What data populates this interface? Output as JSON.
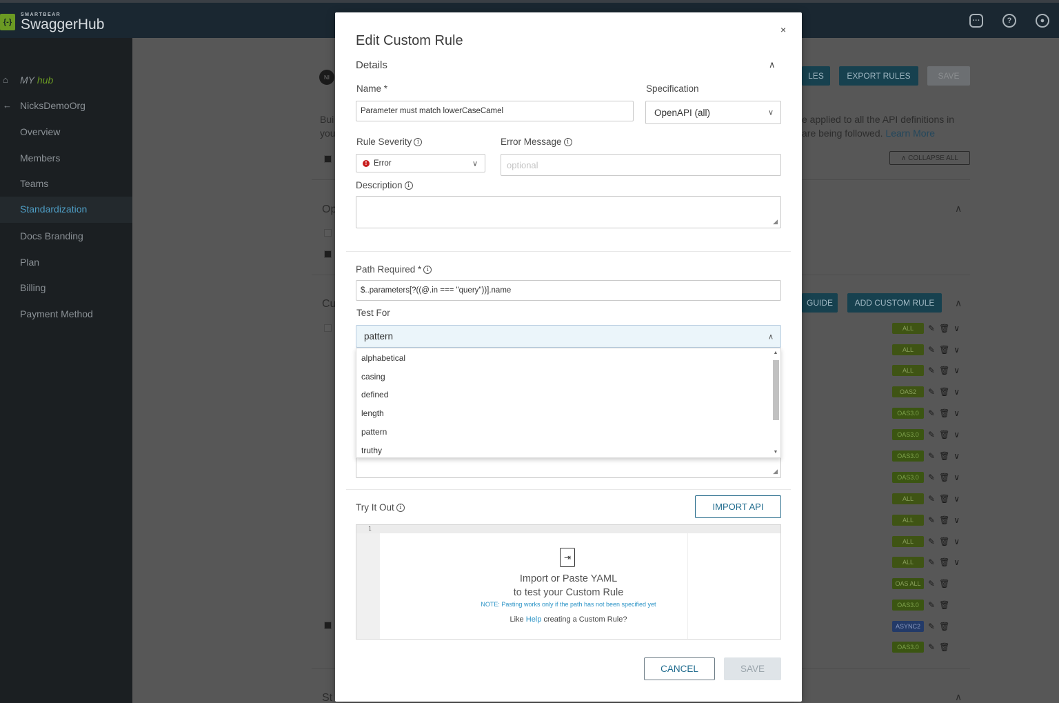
{
  "app": {
    "logo_small": "SMARTBEAR",
    "logo_main": "SwaggerHub",
    "logo_mark": "{-}"
  },
  "sidebar": {
    "myhub_my": "MY",
    "myhub_hub": "hub",
    "org": "NicksDemoOrg",
    "items": [
      {
        "label": "Overview"
      },
      {
        "label": "Members"
      },
      {
        "label": "Teams"
      },
      {
        "label": "Standardization"
      },
      {
        "label": "Docs Branding"
      },
      {
        "label": "Plan"
      },
      {
        "label": "Billing"
      },
      {
        "label": "Payment Method"
      }
    ]
  },
  "background": {
    "avatar_initials": "NI",
    "rules_btn": "LES",
    "export_btn": "EXPORT RULES",
    "save_btn": "SAVE",
    "desc_left1": "Bui",
    "desc_left2": "you",
    "desc_right1": "e applied to all the API definitions in",
    "desc_right2": "are being followed.",
    "learn_more": "Learn More",
    "collapse_all": "∧ COLLAPSE ALL",
    "section_op": "Op",
    "section_cu": "Cu",
    "section_st": "St",
    "guide_btn": "GUIDE",
    "add_custom_rule_btn": "ADD CUSTOM RULE",
    "rule_tags": [
      "ALL",
      "ALL",
      "ALL",
      "OAS2",
      "OAS3.0",
      "OAS3.0",
      "OAS3.0",
      "OAS3.0",
      "ALL",
      "ALL",
      "ALL",
      "ALL",
      "OAS ALL",
      "OAS3.0",
      "ASYNC2",
      "OAS3.0"
    ]
  },
  "modal": {
    "title": "Edit Custom Rule",
    "close": "×",
    "details_title": "Details",
    "name_label": "Name *",
    "name_value": "Parameter must match lowerCaseCamel",
    "spec_label": "Specification",
    "spec_value": "OpenAPI (all)",
    "severity_label": "Rule Severity",
    "severity_value": "Error",
    "error_msg_label": "Error Message",
    "error_msg_placeholder": "optional",
    "description_label": "Description",
    "description_value": "",
    "path_label": "Path Required *",
    "path_value": "$..parameters[?((@.in === \"query\"))].name",
    "test_for_label": "Test For",
    "test_for_value": "pattern",
    "test_for_options": [
      "alphabetical",
      "casing",
      "defined",
      "length",
      "pattern",
      "truthy"
    ],
    "try_it_out_label": "Try It Out",
    "import_api_btn": "IMPORT API",
    "editor_line_number": "1",
    "editor_main_1": "Import or Paste YAML",
    "editor_main_2": "to test your Custom Rule",
    "editor_note": "NOTE: Pasting works only if the path has not been specified yet",
    "editor_help_pre": "Like",
    "editor_help_link": "Help",
    "editor_help_post": "creating a Custom Rule?",
    "cancel_btn": "CANCEL",
    "save_btn": "SAVE"
  },
  "colors": {
    "topbar": "#1a2731",
    "accent": "#1f6b8e",
    "error": "#c81d1d",
    "brand_green": "#6b9a23"
  },
  "icons": [
    "chat-icon",
    "help-icon",
    "user-icon",
    "home-icon",
    "back-arrow-icon",
    "info-icon",
    "chevron-up-icon",
    "chevron-down-icon",
    "import-file-icon",
    "edit-icon",
    "trash-icon"
  ]
}
